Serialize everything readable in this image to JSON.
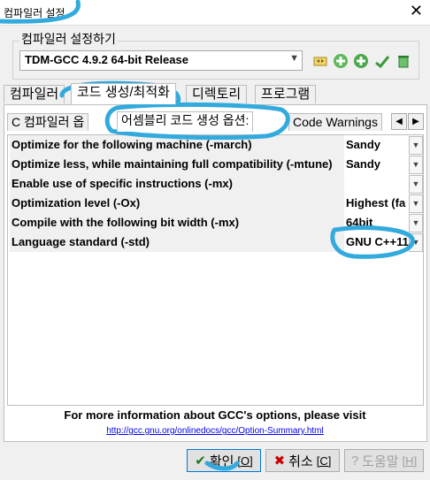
{
  "window": {
    "title": "컴파일러 설정",
    "close_icon": "close-icon"
  },
  "config": {
    "group_label": "컴파일러 설정하기",
    "selected_compiler": "TDM-GCC 4.9.2 64-bit Release",
    "toolbar_icons": [
      "rename-icon",
      "add-icon",
      "add-icon",
      "check-icon",
      "delete-icon"
    ]
  },
  "main_tabs": [
    "컴파일러",
    "코드 생성/최적화",
    "디렉토리",
    "프로그램"
  ],
  "active_main_tab": 1,
  "sub_tabs": [
    "C 컴파일러 옵",
    "어셈블리 코드 생성 옵션:",
    "Code Warnings"
  ],
  "active_sub_tab": 1,
  "options": [
    {
      "label": "Optimize for the following machine (-march)",
      "value": "Sandy"
    },
    {
      "label": "Optimize less, while maintaining full compatibility (-mtune)",
      "value": "Sandy"
    },
    {
      "label": "Enable use of specific instructions (-mx)",
      "value": ""
    },
    {
      "label": "Optimization level (-Ox)",
      "value": "Highest (fa"
    },
    {
      "label": "Compile with the following bit width (-mx)",
      "value": "64bit"
    },
    {
      "label": "Language standard (-std)",
      "value": "GNU C++11"
    }
  ],
  "info": {
    "text": "For more information about GCC's options, please visit",
    "link": "http://gcc.gnu.org/onlinedocs/gcc/Option-Summary.html"
  },
  "buttons": {
    "ok_label": "확인",
    "ok_key": "[O]",
    "cancel_label": "취소",
    "cancel_key": "[C]",
    "help_label": "도움말",
    "help_key": "[H]"
  },
  "colors": {
    "highlight": "#33aadd",
    "link": "#0000ee"
  }
}
